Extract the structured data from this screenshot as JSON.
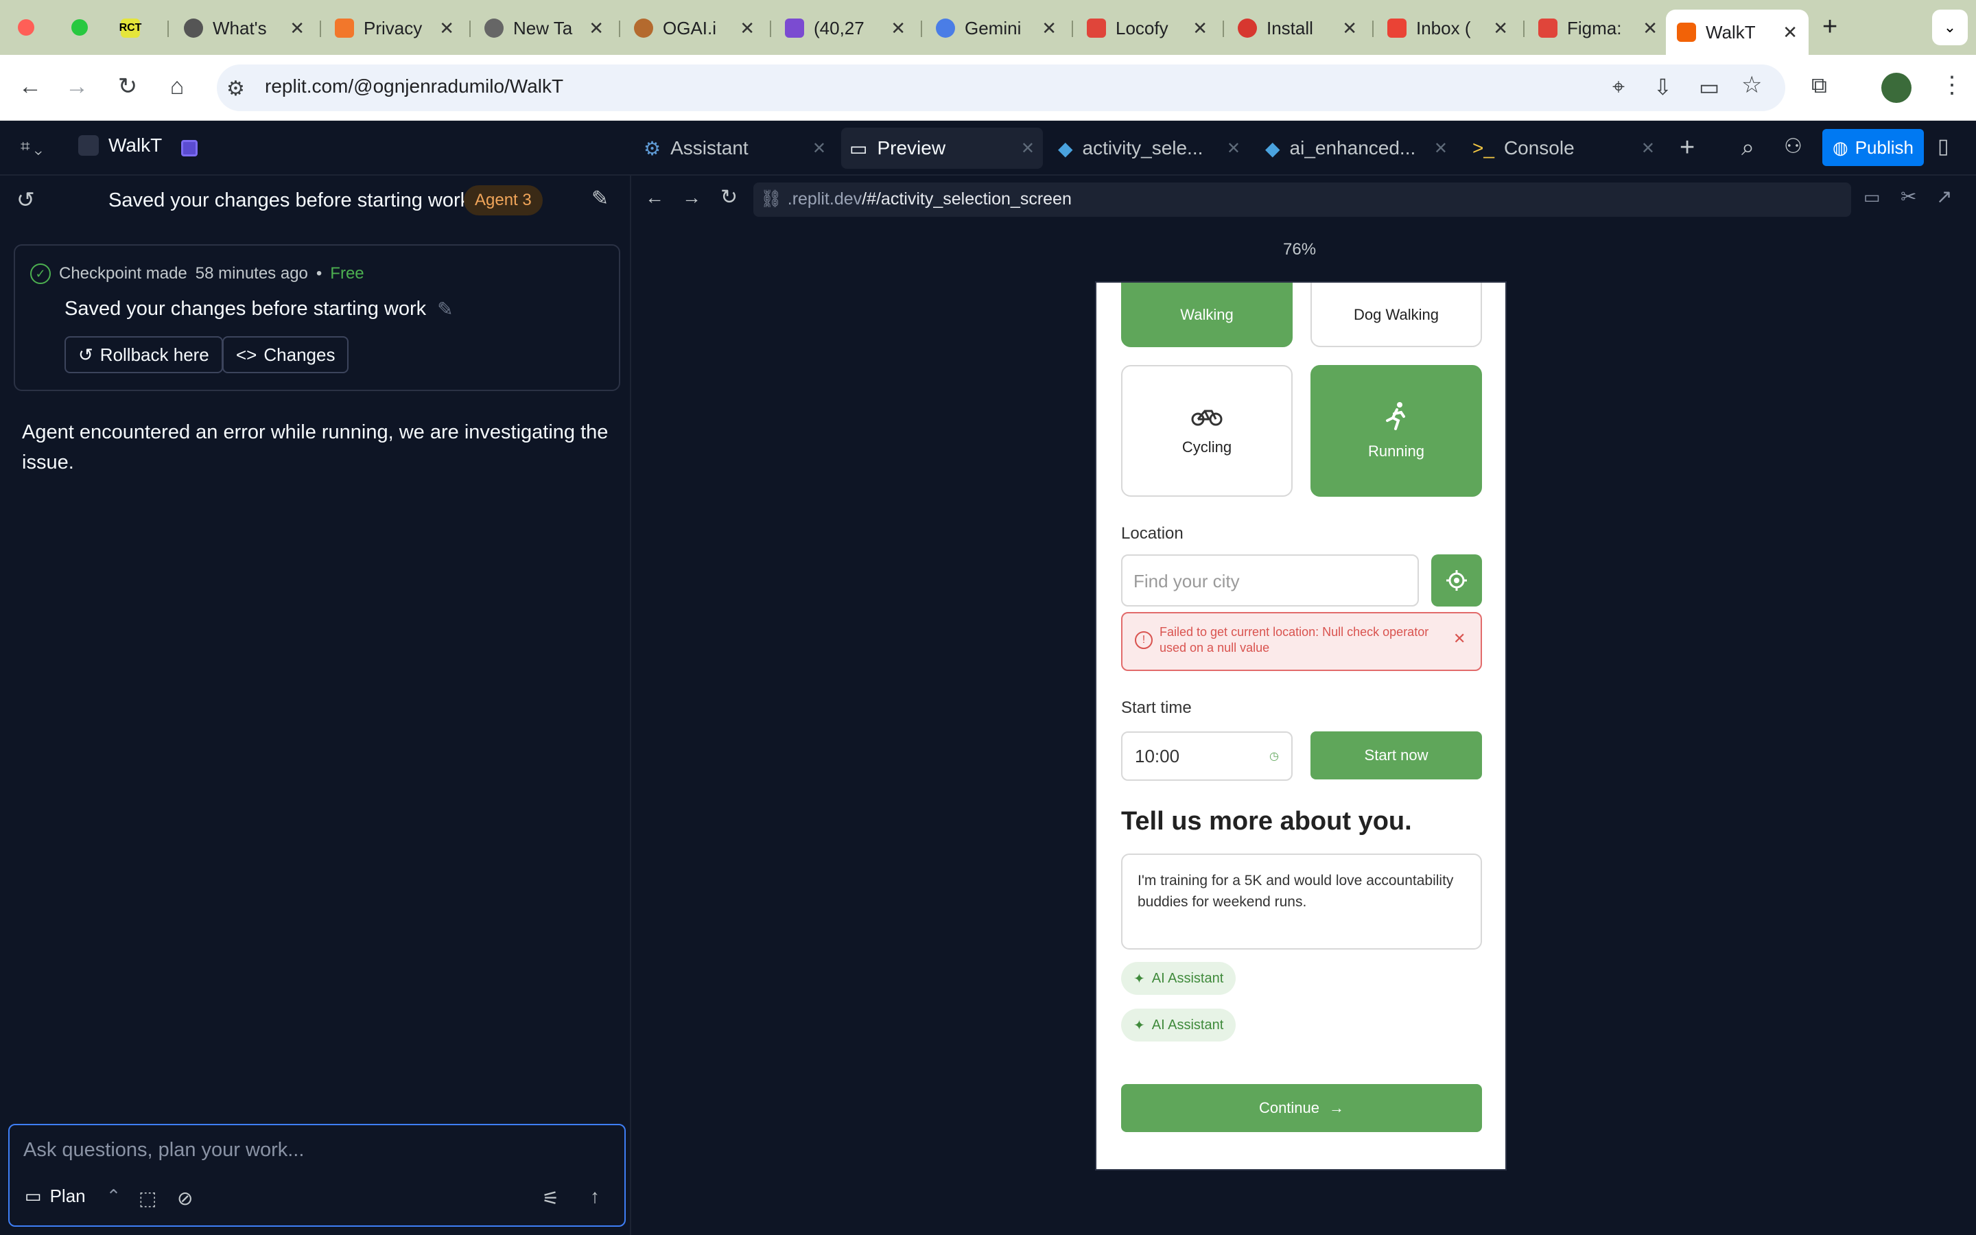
{
  "browser": {
    "tabs": [
      {
        "title": "",
        "fav": "RCT"
      },
      {
        "title": "What's"
      },
      {
        "title": "Privacy"
      },
      {
        "title": "New Ta"
      },
      {
        "title": "OGAI.i"
      },
      {
        "title": "(40,27"
      },
      {
        "title": "Gemini"
      },
      {
        "title": "Locofy"
      },
      {
        "title": "Install"
      },
      {
        "title": "Inbox ("
      },
      {
        "title": "Figma:"
      },
      {
        "title": "WalkT"
      }
    ],
    "url": "replit.com/@ognjenradumilo/WalkT"
  },
  "replit": {
    "project_name": "WalkT",
    "tabs": {
      "assistant": "Assistant",
      "preview": "Preview",
      "activity": "activity_sele...",
      "ai": "ai_enhanced...",
      "console": "Console"
    },
    "publish_label": "Publish"
  },
  "chat": {
    "header_title": "Saved your changes before starting work",
    "agent_badge": "Agent 3",
    "checkpoint": {
      "made_label": "Checkpoint made",
      "time": "58 minutes ago",
      "cost": "Free",
      "title": "Saved your changes before starting work",
      "rollback_label": "Rollback here",
      "changes_label": "Changes"
    },
    "error_message": "Agent encountered an error while running, we are investigating the issue.",
    "input_placeholder": "Ask questions, plan your work...",
    "plan_label": "Plan"
  },
  "preview": {
    "address": ".replit.dev/#/activity_selection_screen",
    "address_host": ".replit.dev",
    "address_path": "/#/activity_selection_screen",
    "zoom": "76%"
  },
  "app": {
    "activities": [
      {
        "label": "Walking",
        "selected": true
      },
      {
        "label": "Dog Walking",
        "selected": false
      },
      {
        "label": "Cycling",
        "selected": false
      },
      {
        "label": "Running",
        "selected": true
      }
    ],
    "location_label": "Location",
    "city_placeholder": "Find your city",
    "error_text": "Failed to get current location: Null check operator used on a null value",
    "start_time_label": "Start time",
    "start_time_value": "10:00",
    "start_now_label": "Start now",
    "about_heading": "Tell us more about you.",
    "about_text": "I'm training for a 5K and would love accountability buddies for weekend runs.",
    "ai_chip_1": "AI Assistant",
    "ai_chip_2": "AI Assistant",
    "continue_label": "Continue"
  },
  "colors": {
    "accent_green": "#5fa65a",
    "replit_blue": "#0079f2",
    "error_red": "#d9534f"
  }
}
